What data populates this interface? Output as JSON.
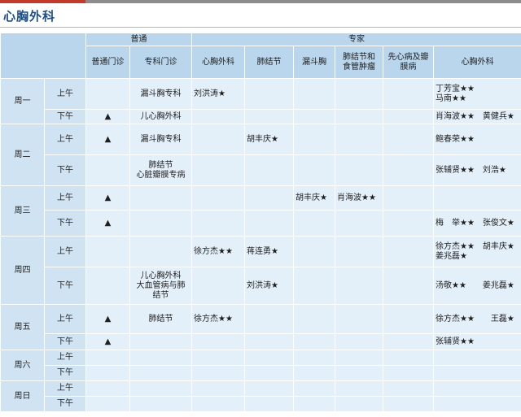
{
  "title": "心胸外科",
  "header": {
    "group_general": "普通",
    "group_expert": "专家",
    "cols": [
      "普通门诊",
      "专科门诊",
      "心胸外科",
      "肺结节",
      "漏斗胸",
      "肺结节和\n食管肿瘤",
      "先心病及瓣\n膜病",
      "心胸外科"
    ]
  },
  "days": [
    {
      "day": "周一",
      "rows": [
        {
          "slot": "上午",
          "cells": [
            "",
            "漏斗胸专科",
            "刘洪涛★",
            "",
            "",
            "",
            "",
            "丁芳宝★★\n马南★★"
          ]
        },
        {
          "slot": "下午",
          "cells": [
            "▲",
            "儿心胸外科",
            "",
            "",
            "",
            "",
            "",
            "肖海波★★　黄健兵★"
          ]
        }
      ]
    },
    {
      "day": "周二",
      "rows": [
        {
          "slot": "上午",
          "cells": [
            "▲",
            "漏斗胸专科",
            "",
            "胡丰庆★",
            "",
            "",
            "",
            "鲍春荣★★"
          ]
        },
        {
          "slot": "下午",
          "cells": [
            "",
            "肺结节\n心脏瓣膜专病",
            "",
            "",
            "",
            "",
            "",
            "张辅贤★★　刘浩★"
          ]
        }
      ]
    },
    {
      "day": "周三",
      "rows": [
        {
          "slot": "上午",
          "cells": [
            "▲",
            "",
            "",
            "",
            "胡丰庆★",
            "肖海波★★",
            "",
            ""
          ]
        },
        {
          "slot": "下午",
          "cells": [
            "▲",
            "",
            "",
            "",
            "",
            "",
            "",
            "梅　举★★　张俊文★"
          ]
        }
      ]
    },
    {
      "day": "周四",
      "rows": [
        {
          "slot": "上午",
          "cells": [
            "",
            "",
            "徐方杰★★",
            "蒋连勇★",
            "",
            "",
            "",
            "徐方杰★★　胡丰庆★\n姜兆磊★"
          ]
        },
        {
          "slot": "下午",
          "cells": [
            "",
            "儿心胸外科\n大血管病与肺\n结节",
            "",
            "刘洪涛★",
            "",
            "",
            "",
            "汤敬★★　　姜兆磊★"
          ]
        }
      ]
    },
    {
      "day": "周五",
      "rows": [
        {
          "slot": "上午",
          "cells": [
            "▲",
            "肺结节",
            "徐方杰★★",
            "",
            "",
            "",
            "",
            "徐方杰★★　　王磊★"
          ]
        },
        {
          "slot": "下午",
          "cells": [
            "▲",
            "",
            "",
            "",
            "",
            "",
            "",
            "张辅贤★★"
          ]
        }
      ]
    },
    {
      "day": "周六",
      "rows": [
        {
          "slot": "上午",
          "cells": [
            "",
            "",
            "",
            "",
            "",
            "",
            "",
            ""
          ]
        },
        {
          "slot": "下午",
          "cells": [
            "",
            "",
            "",
            "",
            "",
            "",
            "",
            ""
          ]
        }
      ]
    },
    {
      "day": "周日",
      "rows": [
        {
          "slot": "上午",
          "cells": [
            "",
            "",
            "",
            "",
            "",
            "",
            "",
            ""
          ]
        },
        {
          "slot": "下午",
          "cells": [
            "",
            "",
            "",
            "",
            "",
            "",
            "",
            ""
          ]
        }
      ]
    }
  ]
}
